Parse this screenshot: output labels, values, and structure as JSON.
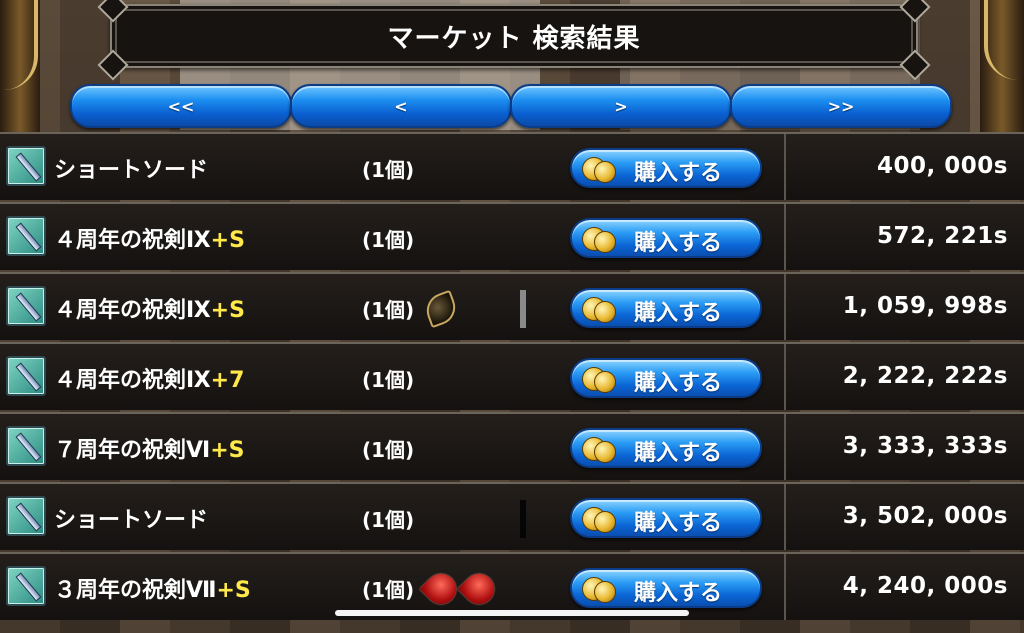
{
  "header": {
    "title": "マーケット 検索結果"
  },
  "nav": {
    "first": "<<",
    "prev": "<",
    "next": ">",
    "last": ">>"
  },
  "buy_label": "購入する",
  "items": [
    {
      "name": "ショートソード",
      "suffix": "",
      "qty": "(1個)",
      "price": "400, 000s",
      "gems": []
    },
    {
      "name": "４周年の祝剣Ⅸ",
      "suffix": "+S",
      "qty": "(1個)",
      "price": "572, 221s",
      "gems": []
    },
    {
      "name": "４周年の祝剣Ⅸ",
      "suffix": "+S",
      "qty": "(1個)",
      "price": "1, 059, 998s",
      "gems": [
        "dark"
      ]
    },
    {
      "name": "４周年の祝剣Ⅸ",
      "suffix": "+7",
      "qty": "(1個)",
      "price": "2, 222, 222s",
      "gems": []
    },
    {
      "name": "７周年の祝剣Ⅵ",
      "suffix": "+S",
      "qty": "(1個)",
      "price": "3, 333, 333s",
      "gems": []
    },
    {
      "name": "ショートソード",
      "suffix": "",
      "qty": "(1個)",
      "price": "3, 502, 000s",
      "gems": []
    },
    {
      "name": "３周年の祝剣Ⅶ",
      "suffix": "+S",
      "qty": "(1個)",
      "price": "4, 240, 000s",
      "gems": [
        "red",
        "red"
      ]
    }
  ],
  "colors": {
    "suffix": "#ffe94a",
    "button_blue": "#1c8ef0"
  }
}
